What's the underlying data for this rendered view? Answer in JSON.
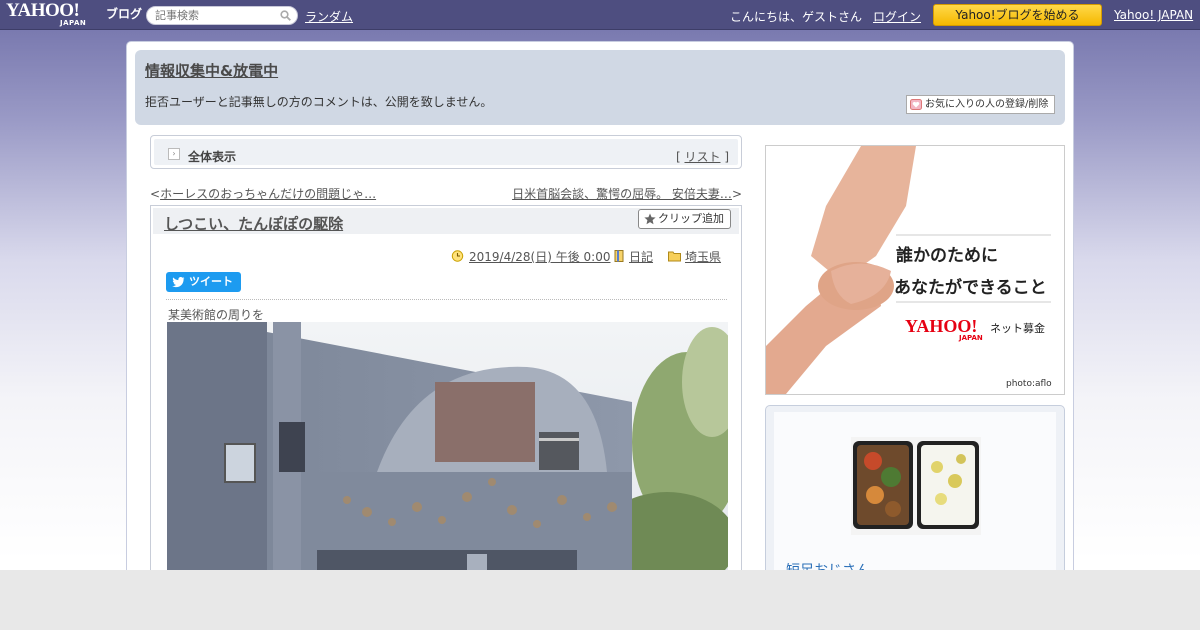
{
  "topbar": {
    "logo_text": "YAHOO!",
    "logo_sub": "JAPAN",
    "logo_blog": "ブログ",
    "search_placeholder": "記事検索",
    "random_link": "ランダム",
    "greeting": "こんにちは、ゲストさん",
    "login_link": "ログイン",
    "start_button": "Yahoo!ブログを始める",
    "yahoo_japan_link": "Yahoo! JAPAN"
  },
  "header": {
    "blog_title": "情報収集中&放電中",
    "description": "拒否ユーザーと記事無しの方のコメントは、公開を致しません。",
    "favorite_button": "お気に入りの人の登録/削除"
  },
  "view_bar": {
    "label": "全体表示",
    "list_link": "リスト",
    "bracket_open": "[ ",
    "bracket_close": " ]"
  },
  "navigation": {
    "prev_arrow": "<",
    "prev_link": "ホーレスのおっちゃんだけの問題じゃ…",
    "next_link": "日米首脳会談、驚愕の屈辱。 安倍夫妻…",
    "next_arrow": ">"
  },
  "article": {
    "title": "しつこい、たんぽぽの駆除",
    "clip_button": "クリップ追加",
    "date": "2019/4/28(日) 午後 0:00",
    "category": "日記",
    "folder": "埼玉県",
    "tweet_button": "ツイート",
    "caption": "某美術館の周りを"
  },
  "ad": {
    "line1": "誰かのために",
    "line2": "あなたができること",
    "brand": "YAHOO!",
    "brand_sub": "JAPAN",
    "service": "ネット募金",
    "credit": "photo:aflo"
  },
  "sidebar": {
    "profile_name": "短足おじさん"
  },
  "colors": {
    "topbar": "#4e4e80",
    "accent_button": "#f5b800",
    "header_bg": "#d0d8e4",
    "tweet": "#1d9bf0",
    "link_blue": "#2a6fb8"
  },
  "icons": [
    "search-icon",
    "heart-icon",
    "star-icon",
    "clock-icon",
    "diary-icon",
    "folder-icon",
    "twitter-bird-icon"
  ]
}
